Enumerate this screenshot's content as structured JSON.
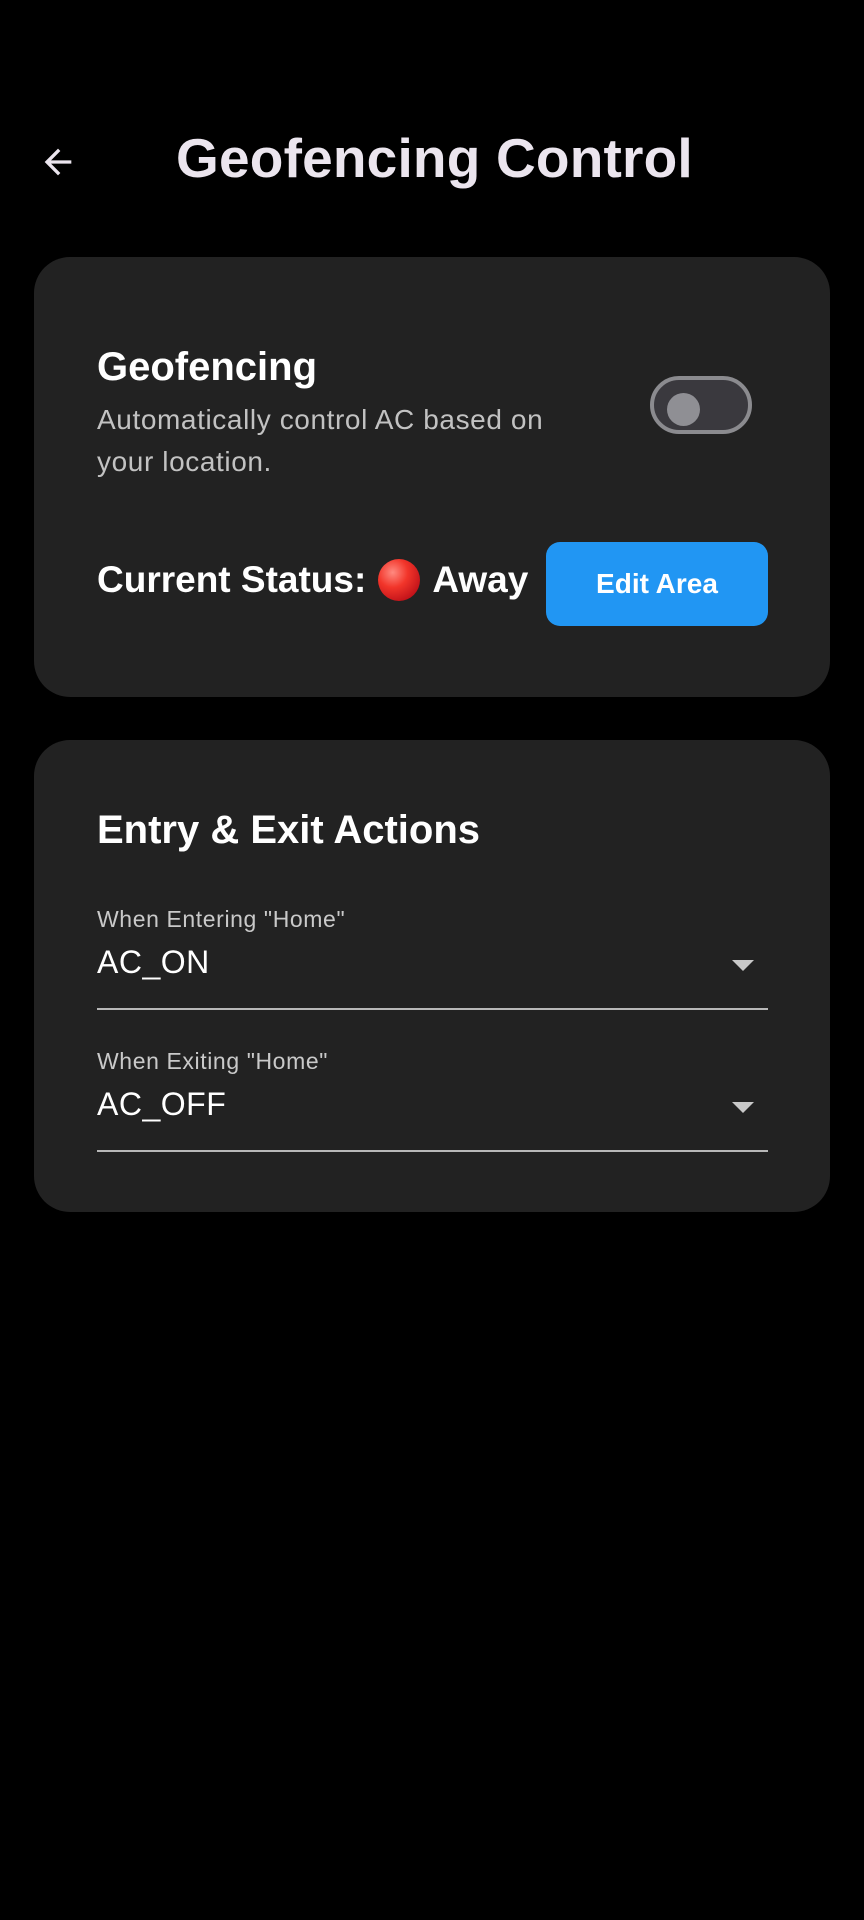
{
  "app_bar": {
    "title": "Geofencing Control",
    "back_icon": "arrow-left-icon"
  },
  "geofencing_card": {
    "title": "Geofencing",
    "description": "Automatically control AC based on your location.",
    "toggle_enabled": false,
    "status_label": "Current Status:",
    "status_icon": "red-circle-icon",
    "status_value": "Away",
    "edit_button_label": "Edit Area"
  },
  "actions_card": {
    "title": "Entry & Exit Actions",
    "entering": {
      "label": "When Entering \"Home\"",
      "value": "AC_ON"
    },
    "exiting": {
      "label": "When Exiting \"Home\"",
      "value": "AC_OFF"
    }
  },
  "colors": {
    "background": "#000000",
    "card": "#222222",
    "accent_button": "#2196f3",
    "title_text": "#ebe5ee",
    "status_dot": "#e53935"
  }
}
